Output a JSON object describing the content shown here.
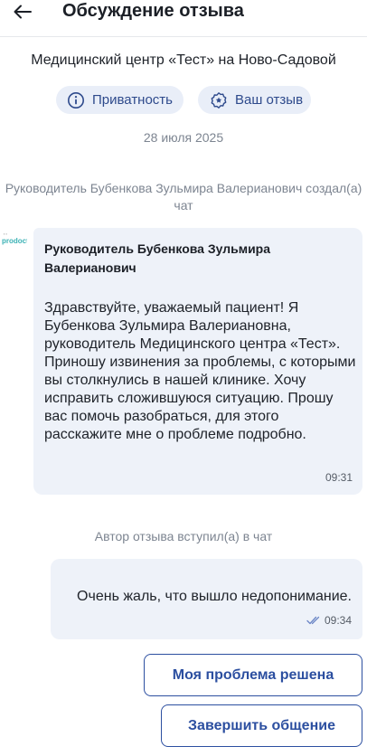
{
  "header": {
    "title": "Обсуждение отзыва",
    "back_icon": "arrow-left-icon"
  },
  "clinic_name": "Медицинский центр «Тест» на Ново-Садовой",
  "chips": {
    "privacy": {
      "label": "Приватность",
      "icon": "info-icon"
    },
    "review": {
      "label": "Ваш отзыв",
      "icon": "badge-star-icon"
    }
  },
  "date": "28 июля 2025",
  "system_messages": {
    "chat_created": "Руководитель Бубенкова Зульмира Валерианович создал(а) чат",
    "author_joined": "Автор отзыва вступил(а) в чат"
  },
  "incoming_message": {
    "sender": "Руководитель Бубенкова Зульмира Валерианович",
    "avatar_text": "prodoctorov",
    "text": "Здравствуйте, уважаемый пациент! Я Бубенкова Зульмира Валериановна, руководитель Медицинского центра «Тест». Приношу извинения за проблемы, с которыми вы столкнулись в нашей клинике. Хочу исправить сложившуюся ситуацию. Прошу вас помочь разобраться, для этого расскажите мне о проблеме подробно.",
    "time": "09:31"
  },
  "outgoing_message": {
    "text": "Очень жаль, что вышло недопонимание.",
    "time": "09:34",
    "status_icon": "double-check-icon"
  },
  "buttons": {
    "problem_solved": "Моя проблема решена",
    "finish_chat": "Завершить общение"
  },
  "colors": {
    "accent": "#2c4fa0",
    "chip_bg": "#e9eef8",
    "bubble_bg": "#eef2f9",
    "muted_text": "#7d8591"
  }
}
